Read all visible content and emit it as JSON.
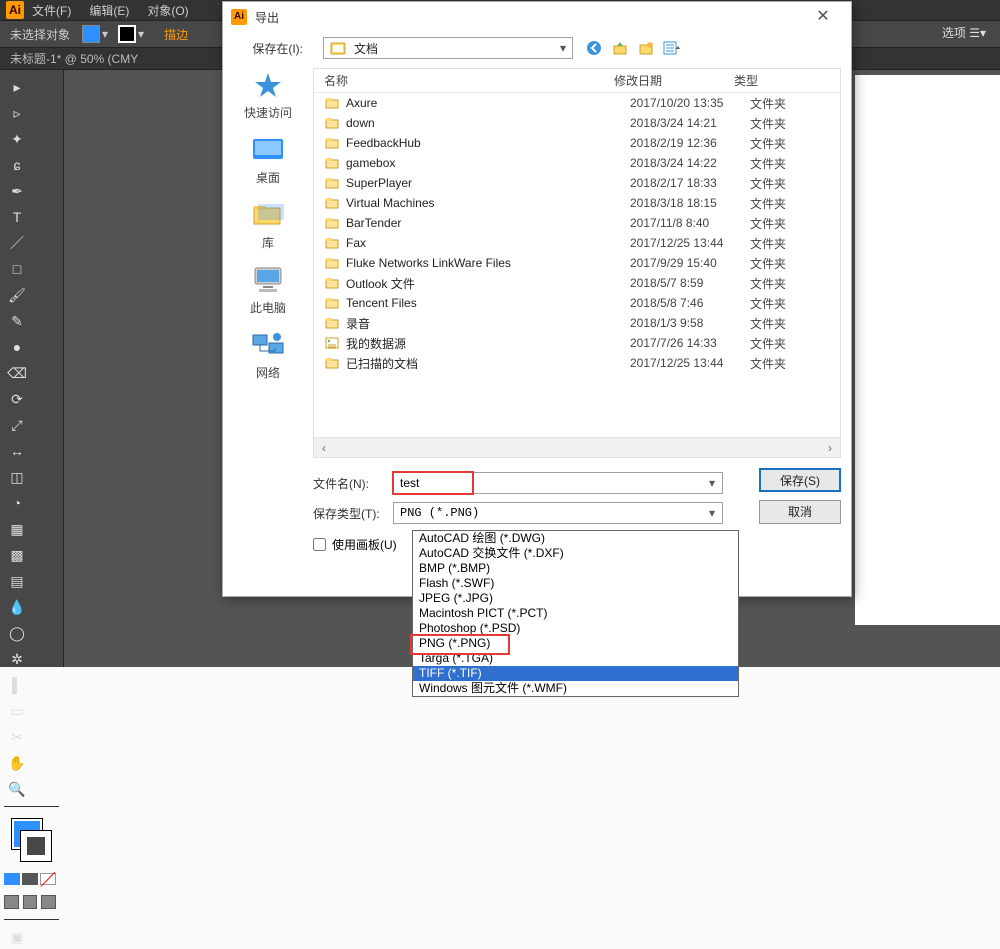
{
  "ai": {
    "menu": {
      "file": "文件(F)",
      "edit": "编辑(E)",
      "object": "对象(O)"
    },
    "noSelection": "未选择对象",
    "orange": "描边",
    "rightOptions": "选项 ☰▾",
    "tab": "未标题-1* @ 50% (CMY"
  },
  "dialog": {
    "title": "导出",
    "saveInLabel": "保存在(I):",
    "saveInValue": "文档",
    "places": {
      "quick": "快速访问",
      "desktop": "桌面",
      "lib": "库",
      "pc": "此电脑",
      "net": "网络"
    },
    "columns": {
      "name": "名称",
      "date": "修改日期",
      "type": "类型"
    },
    "rows": [
      {
        "name": "Axure",
        "date": "2017/10/20 13:35",
        "type": "文件夹",
        "kind": "folder"
      },
      {
        "name": "down",
        "date": "2018/3/24 14:21",
        "type": "文件夹",
        "kind": "folder"
      },
      {
        "name": "FeedbackHub",
        "date": "2018/2/19 12:36",
        "type": "文件夹",
        "kind": "folder"
      },
      {
        "name": "gamebox",
        "date": "2018/3/24 14:22",
        "type": "文件夹",
        "kind": "folder"
      },
      {
        "name": "SuperPlayer",
        "date": "2018/2/17 18:33",
        "type": "文件夹",
        "kind": "folder"
      },
      {
        "name": "Virtual Machines",
        "date": "2018/3/18 18:15",
        "type": "文件夹",
        "kind": "folder"
      },
      {
        "name": "BarTender",
        "date": "2017/11/8 8:40",
        "type": "文件夹",
        "kind": "folder"
      },
      {
        "name": "Fax",
        "date": "2017/12/25 13:44",
        "type": "文件夹",
        "kind": "folder"
      },
      {
        "name": "Fluke Networks LinkWare Files",
        "date": "2017/9/29 15:40",
        "type": "文件夹",
        "kind": "folder"
      },
      {
        "name": "Outlook 文件",
        "date": "2018/5/7 8:59",
        "type": "文件夹",
        "kind": "folder"
      },
      {
        "name": "Tencent Files",
        "date": "2018/5/8 7:46",
        "type": "文件夹",
        "kind": "folder"
      },
      {
        "name": "录音",
        "date": "2018/1/3 9:58",
        "type": "文件夹",
        "kind": "folder"
      },
      {
        "name": "我的数据源",
        "date": "2017/7/26 14:33",
        "type": "文件夹",
        "kind": "datasource"
      },
      {
        "name": "已扫描的文档",
        "date": "2017/12/25 13:44",
        "type": "文件夹",
        "kind": "folder"
      }
    ],
    "filenameLabel": "文件名(N):",
    "filenameValue": "test",
    "filetypeLabel": "保存类型(T):",
    "filetypeValue": "PNG (*.PNG)",
    "saveBtn": "保存(S)",
    "cancelBtn": "取消",
    "artboard": "使用画板(U)",
    "formats": [
      "AutoCAD 绘图 (*.DWG)",
      "AutoCAD 交换文件 (*.DXF)",
      "BMP (*.BMP)",
      "Flash (*.SWF)",
      "JPEG (*.JPG)",
      "Macintosh PICT (*.PCT)",
      "Photoshop (*.PSD)",
      "PNG (*.PNG)",
      "Targa (*.TGA)",
      "TIFF (*.TIF)",
      "Windows 图元文件 (*.WMF)"
    ],
    "formatHighlightIdx": 7,
    "formatSelectedIdx": 9
  }
}
